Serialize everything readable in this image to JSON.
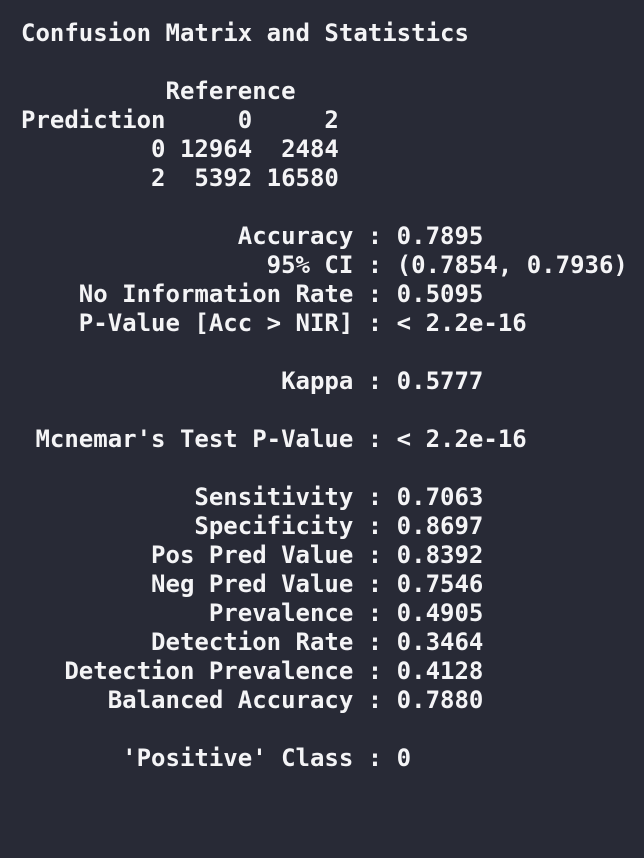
{
  "console": {
    "lines": [
      "Confusion Matrix and Statistics",
      "",
      "          Reference",
      "Prediction     0     2",
      "         0 12964  2484",
      "         2  5392 16580",
      "",
      "               Accuracy : 0.7895",
      "                 95% CI : (0.7854, 0.7936)",
      "    No Information Rate : 0.5095",
      "    P-Value [Acc > NIR] : < 2.2e-16",
      "",
      "                  Kappa : 0.5777",
      "",
      " Mcnemar's Test P-Value : < 2.2e-16",
      "",
      "            Sensitivity : 0.7063",
      "            Specificity : 0.8697",
      "         Pos Pred Value : 0.8392",
      "         Neg Pred Value : 0.7546",
      "             Prevalence : 0.4905",
      "         Detection Rate : 0.3464",
      "   Detection Prevalence : 0.4128",
      "      Balanced Accuracy : 0.7880",
      "",
      "       'Positive' Class : 0"
    ]
  },
  "colors": {
    "background": "#282a36",
    "text": "#f4f4f6"
  }
}
